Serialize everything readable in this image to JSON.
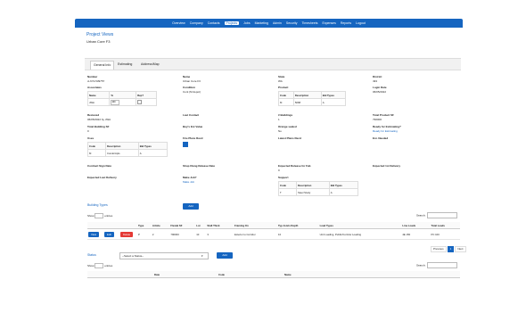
{
  "nav": {
    "items": [
      "Overview",
      "Company",
      "Contacts",
      "Projects",
      "Jobs",
      "Marketing",
      "Admin",
      "Security",
      "Timesheets",
      "Expenses",
      "Reports",
      "Logout"
    ],
    "active_index": 3
  },
  "page": {
    "title": "Project Views",
    "subtitle": "Urban Core F3"
  },
  "tabs": [
    "General Info",
    "Estimating",
    "Address/Map"
  ],
  "fields": {
    "number": {
      "label": "Number",
      "value": "ci-674-539757"
    },
    "name": {
      "label": "Name",
      "value": "Urban Core F3"
    },
    "state": {
      "label": "State",
      "value": "WA"
    },
    "district": {
      "label": "District",
      "value": "493"
    },
    "associates": {
      "label": "Associates"
    },
    "condition": {
      "label": "Condition",
      "value": "Cont (M depot)"
    },
    "product": {
      "label": "Product"
    },
    "login_date": {
      "label": "Login Date",
      "value": "06/05/2022"
    },
    "received": {
      "label": "Recieved",
      "value": "06/05/2022 by JWA"
    },
    "last_contact": {
      "label": "Last Contact"
    },
    "num_buildings": {
      "label": "# Buildings",
      "value": "1"
    },
    "total_product": {
      "label": "Total Product SF",
      "value": "790000"
    },
    "total_building": {
      "label": "Total Building SF",
      "value": "0"
    },
    "buys_est_value": {
      "label": "Buy's Est Value"
    },
    "orange_sealed": {
      "label": "Orange sealed",
      "value": "No"
    },
    "ready_for_estimating": {
      "label": "Ready for Estimating?",
      "value": "Ready for Estimating"
    },
    "uses": {
      "label": "Uses"
    },
    "fire_plans_recd": {
      "label": "Fire Plans Recd"
    },
    "latest_plans_recd": {
      "label": "Latest Plans Recd"
    },
    "est_needed": {
      "label": "Est. Needed"
    },
    "contract_sign_date": {
      "label": "Contract Sign Date"
    },
    "shop_dwg": {
      "label": "Shop Dwng Release Date"
    },
    "expected_release": {
      "label": "Expected Release for Fab",
      "value": "0"
    },
    "expected_1st_delivery": {
      "label": "Expected 1st Delivery"
    },
    "expected_last_delivery": {
      "label": "Expected Last Delivery"
    },
    "make_job": {
      "label": "Make Job?",
      "value": "Make Job"
    },
    "support": {
      "label": "Support"
    }
  },
  "associates_table": {
    "headers": [
      "Name",
      "%",
      "Rep?"
    ],
    "rows": [
      {
        "name": "JWin",
        "pct": "100"
      }
    ]
  },
  "product_table": {
    "headers": [
      "Code",
      "Description",
      "Bid Types"
    ],
    "rows": [
      [
        "M",
        "5068",
        "A"
      ]
    ]
  },
  "uses_table": {
    "headers": [
      "Code",
      "Description",
      "Bid Types"
    ],
    "rows": [
      [
        "M",
        "Condo/Apts",
        "A"
      ]
    ]
  },
  "support_table": {
    "headers": [
      "Code",
      "Description",
      "Bid Types"
    ],
    "rows": [
      [
        "T",
        "Steel Study",
        "A"
      ]
    ]
  },
  "add_label": "Add",
  "building_types": {
    "title": "Building Types",
    "show_prefix": "Show",
    "show_suffix": "entries",
    "search_label": "Search:",
    "columns": [
      "",
      "",
      "",
      "Type",
      "Article",
      "Flexial SF",
      "Lot",
      "Stall Thick",
      "Framing On",
      "Typ Joists Depth",
      "Load Types",
      "Line Loads",
      "Total Loads"
    ],
    "rows": [
      {
        "view": "View",
        "edit": "Edit",
        "delete": "Delete",
        "type": "P",
        "article": "2",
        "flexial": "790000",
        "lot": "10",
        "stall": "3",
        "framing": "Exterior to Corridor",
        "depth": "10",
        "load_types": "Unit Loading, Public/Corridor Loading",
        "line_loads": "4E 150",
        "total_loads": "PC 100"
      }
    ],
    "pager": {
      "prev": "Previous",
      "page": "1",
      "next": "Next"
    }
  },
  "status_section": {
    "title": "Status",
    "select_placeholder": "--Select a Status--",
    "show_prefix": "Show",
    "show_suffix": "entries",
    "search_label": "Search:",
    "columns": [
      "",
      "Date",
      "Code",
      "Name"
    ]
  }
}
